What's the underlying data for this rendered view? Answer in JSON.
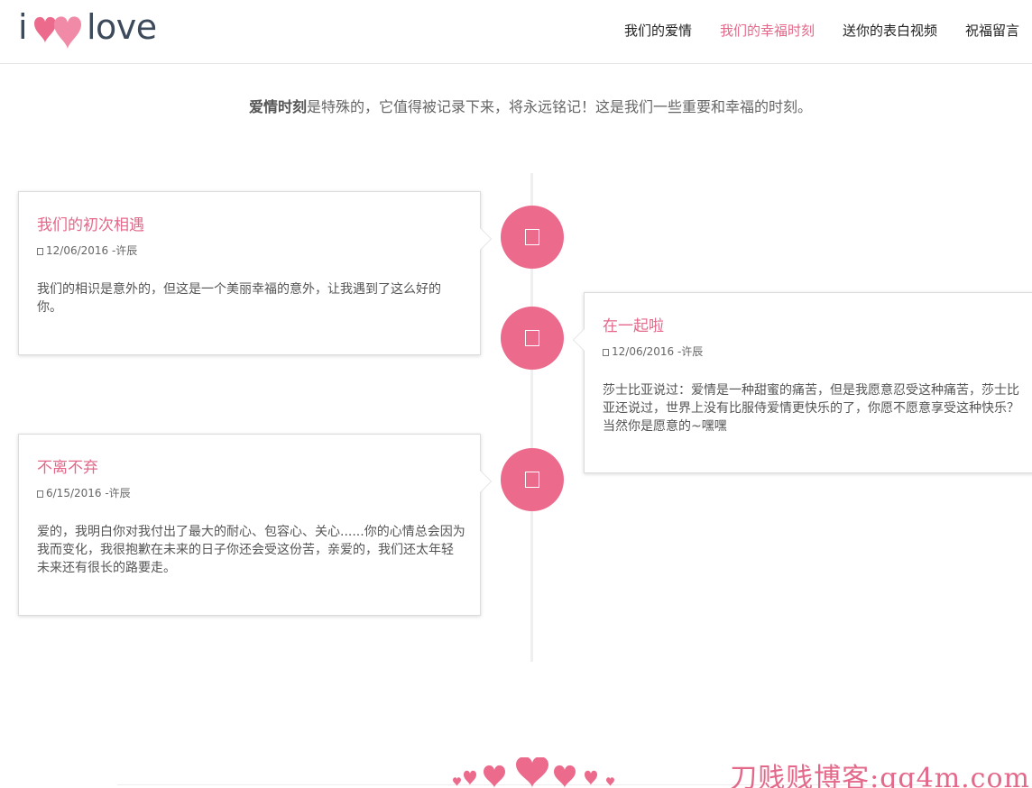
{
  "logo": {
    "i": "i",
    "love": "love",
    "heart_color": "#ec6b8c"
  },
  "nav": {
    "items": [
      {
        "label": "我们的爱情"
      },
      {
        "label": "我们的幸福时刻"
      },
      {
        "label": "送你的表白视频"
      },
      {
        "label": "祝福留言"
      }
    ],
    "active_index": 1
  },
  "intro": {
    "bold": "爱情时刻",
    "text": "是特殊的，它值得被记录下来，将永远铭记！这是我们一些重要和幸福的时刻。"
  },
  "timeline": {
    "items": [
      {
        "title": "我们的初次相遇",
        "meta": "12/06/2016 -许辰",
        "body": "我们的相识是意外的，但这是一个美丽幸福的意外，让我遇到了这么好的你。"
      },
      {
        "title": "在一起啦",
        "meta": "12/06/2016 -许辰",
        "body": "莎士比亚说过：爱情是一种甜蜜的痛苦，但是我愿意忍受这种痛苦，莎士比亚还说过，世界上没有比服侍爱情更快乐的了，你愿不愿意享受这种快乐？当然你是愿意的~嘿嘿"
      },
      {
        "title": "不离不弃",
        "meta": "6/15/2016 -许辰",
        "body": "爱的，我明白你对我付出了最大的耐心、包容心、关心......你的心情总会因为我而变化，我很抱歉在未来的日子你还会受这份苦，亲爱的，我们还太年轻未来还有很长的路要走。"
      }
    ]
  },
  "footer": {
    "watermark": "刀贱贱博客:qq4m.com"
  },
  "colors": {
    "accent": "#e3688a",
    "node": "#ec6b8c",
    "text": "#555555"
  }
}
